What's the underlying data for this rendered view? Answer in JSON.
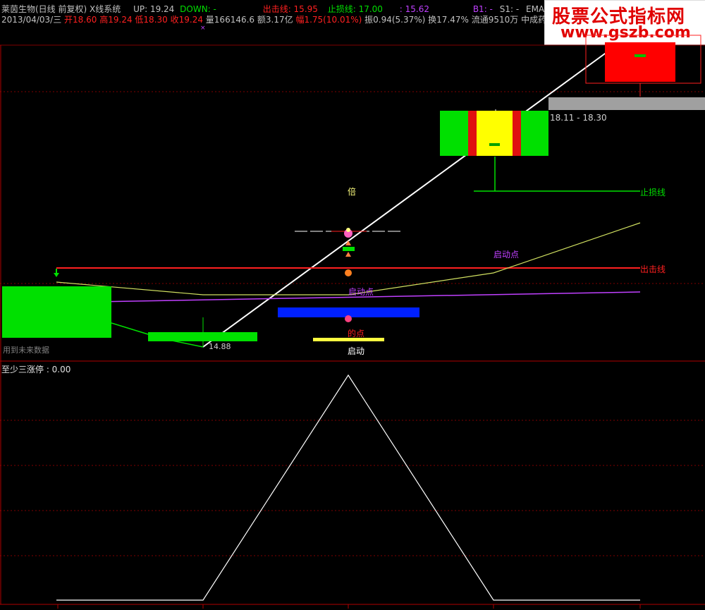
{
  "header": {
    "stock_name": "莱茵生物(日线 前复权)",
    "system": "X线系统",
    "up": "UP: 19.24",
    "down": "DOWN: -",
    "attack_line": "出击线: 15.95",
    "stop_line": "止损线: 17.00",
    "partial_value": ": 15.62",
    "b1": "B1: -",
    "s1": "S1: -",
    "ema5": "EMA5: 16.57"
  },
  "quote": {
    "date": "2013/04/03/三",
    "open": "开18.60",
    "high": "高19.24",
    "low": "低18.30",
    "close": "收19.24",
    "volume": "量166146.6",
    "amount": "额3.17亿",
    "change": "幅1.75(10.01%)",
    "amplitude": "振0.94(5.37%)",
    "turnover": "换17.47%",
    "float": "流通9510万",
    "sector": "中成药"
  },
  "watermark": {
    "line1": "股票公式指标网",
    "line2": "www.gszb.com"
  },
  "chart_labels": {
    "price_range": "18.11 - 18.30",
    "stop_loss_label": "止损线",
    "attack_label": "出击线",
    "start_point_upper": "启动点",
    "start_point_lower": "启动点",
    "bei": "倍",
    "di_dian": "的点",
    "qi_dong": "启动",
    "low_value": "14.88",
    "future_data": "用到未来数据",
    "small_marker": "×"
  },
  "lower_panel": {
    "title": "至少三涨停 : 0.00"
  },
  "colors": {
    "red": "#ff2020",
    "green": "#00e000",
    "yellow": "#ffff00",
    "blue": "#0020ff",
    "magenta": "#c040ff",
    "white": "#ffffff",
    "grid": "#800000"
  },
  "chart_data": {
    "type": "line",
    "series": [
      {
        "values": [
          0,
          0,
          1,
          0,
          0
        ]
      }
    ],
    "ylim": [
      0,
      1
    ]
  }
}
